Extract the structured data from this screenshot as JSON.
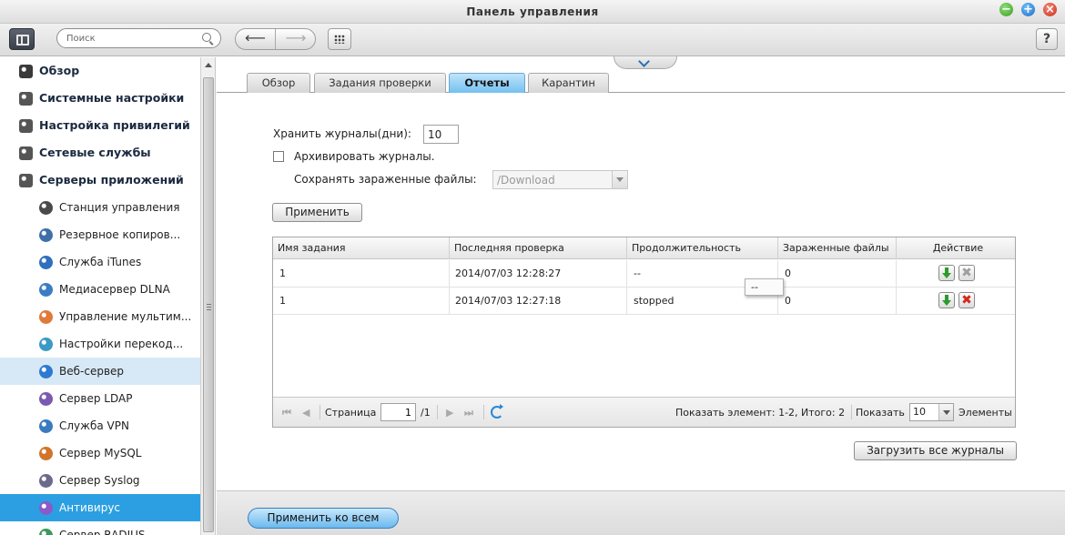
{
  "window": {
    "title": "Панель управления"
  },
  "toolbar": {
    "search_placeholder": "Поиск",
    "back_glyph": "⟵",
    "forward_glyph": "⟶",
    "help_label": "?"
  },
  "sidebar": {
    "items": [
      {
        "label": "Обзор",
        "level": "top",
        "icon": "overview-icon",
        "color": "#3a3a3a"
      },
      {
        "label": "Системные настройки",
        "level": "top",
        "icon": "gear-icon",
        "color": "#555555"
      },
      {
        "label": "Настройка привилегий",
        "level": "top",
        "icon": "user-icon",
        "color": "#555555"
      },
      {
        "label": "Сетевые службы",
        "level": "top",
        "icon": "globe-icon",
        "color": "#555555"
      },
      {
        "label": "Серверы приложений",
        "level": "top",
        "icon": "app-servers-icon",
        "color": "#555555"
      },
      {
        "label": "Станция управления",
        "level": "sub",
        "icon": "management-station-icon",
        "color": "#4a4a4a"
      },
      {
        "label": "Резервное копиров...",
        "level": "sub",
        "icon": "backup-icon",
        "color": "#3e6fa8"
      },
      {
        "label": "Служба iTunes",
        "level": "sub",
        "icon": "itunes-icon",
        "color": "#2f6fbf"
      },
      {
        "label": "Медиасервер DLNA",
        "level": "sub",
        "icon": "dlna-icon",
        "color": "#3b7dc4"
      },
      {
        "label": "Управление мультим...",
        "level": "sub",
        "icon": "multimedia-icon",
        "color": "#e07a3a"
      },
      {
        "label": "Настройки перекод...",
        "level": "sub",
        "icon": "transcode-icon",
        "color": "#3a9ac4"
      },
      {
        "label": "Веб-сервер",
        "level": "sub",
        "icon": "web-server-icon",
        "color": "#2f7ad0",
        "state": "hover"
      },
      {
        "label": "Сервер LDAP",
        "level": "sub",
        "icon": "ldap-icon",
        "color": "#7a5ab0"
      },
      {
        "label": "Служба VPN",
        "level": "sub",
        "icon": "vpn-icon",
        "color": "#3a7abf"
      },
      {
        "label": "Сервер MySQL",
        "level": "sub",
        "icon": "mysql-icon",
        "color": "#d0752a"
      },
      {
        "label": "Сервер Syslog",
        "level": "sub",
        "icon": "syslog-icon",
        "color": "#6a6a8a"
      },
      {
        "label": "Антивирус",
        "level": "sub",
        "icon": "antivirus-icon",
        "color": "#8a5ac8",
        "state": "selected"
      },
      {
        "label": "Сервер RADIUS",
        "level": "sub",
        "icon": "radius-icon",
        "color": "#3a9a5a"
      }
    ]
  },
  "tabs": [
    {
      "label": "Обзор",
      "active": false
    },
    {
      "label": "Задания проверки",
      "active": false
    },
    {
      "label": "Отчеты",
      "active": true
    },
    {
      "label": "Карантин",
      "active": false
    }
  ],
  "form": {
    "keep_logs_label": "Хранить журналы(дни):",
    "keep_logs_value": "10",
    "archive_label": "Архивировать журналы.",
    "archive_checked": false,
    "save_infected_label": "Сохранять зараженные файлы:",
    "save_infected_value": "/Download",
    "apply_label": "Применить"
  },
  "grid": {
    "columns": [
      "Имя задания",
      "Последняя проверка",
      "Продолжительность",
      "Зараженные файлы",
      "Действие"
    ],
    "rows": [
      {
        "name": "1",
        "last_check": "2014/07/03 12:28:27",
        "duration": "--",
        "infected": "0",
        "delete_enabled": false
      },
      {
        "name": "1",
        "last_check": "2014/07/03 12:27:18",
        "duration": "stopped",
        "infected": "0",
        "delete_enabled": true
      }
    ],
    "tooltip": "--",
    "delete_glyph": "✖"
  },
  "pager": {
    "first": "⏮",
    "prev": "◀",
    "next": "▶",
    "last": "⏭",
    "page_label": "Страница",
    "page_value": "1",
    "total_pages": "/1",
    "summary": "Показать элемент: 1-2, Итого: 2",
    "show_label": "Показать",
    "show_value": "10",
    "items_label": "Элементы"
  },
  "download_all_label": "Загрузить все журналы",
  "apply_all_label": "Применить ко всем",
  "colors": {
    "accent": "#2b9fe2",
    "hover": "#d7e9f6",
    "tab_active": "#74c0f0"
  }
}
